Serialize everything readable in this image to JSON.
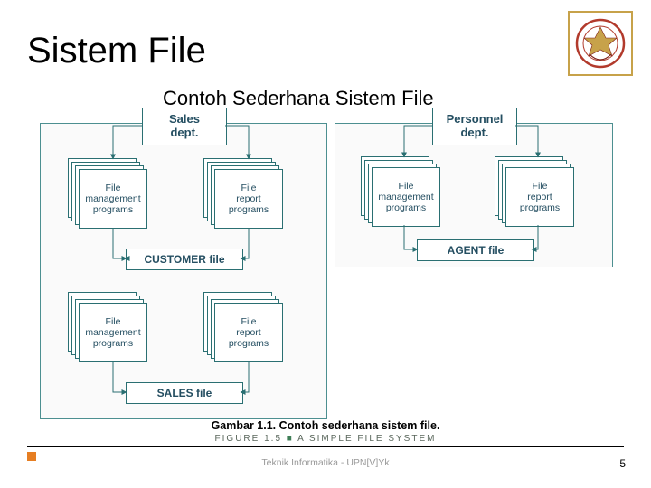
{
  "page": {
    "title": "Sistem File",
    "subtitle": "Contoh Sederhana Sistem File",
    "caption": "Gambar 1.1. Contoh sederhana sistem file.",
    "figure_line_label": "FIGURE 1.5",
    "figure_line_text": "A SIMPLE FILE SYSTEM",
    "footer": "Teknik Informatika - UPN[V]Yk",
    "page_number": "5"
  },
  "diagram": {
    "left_panel": {
      "dept": "Sales\ndept.",
      "stack_mgmt": "File\nmanagement\nprograms",
      "stack_rpt": "File\nreport\nprograms",
      "file1": "CUSTOMER file",
      "file2": "SALES file"
    },
    "right_panel": {
      "dept": "Personnel\ndept.",
      "stack_mgmt": "File\nmanagement\nprograms",
      "stack_rpt": "File\nreport\nprograms",
      "file1": "AGENT file"
    }
  },
  "colors": {
    "teal": "#2a6f72",
    "accent": "#e67e22"
  }
}
